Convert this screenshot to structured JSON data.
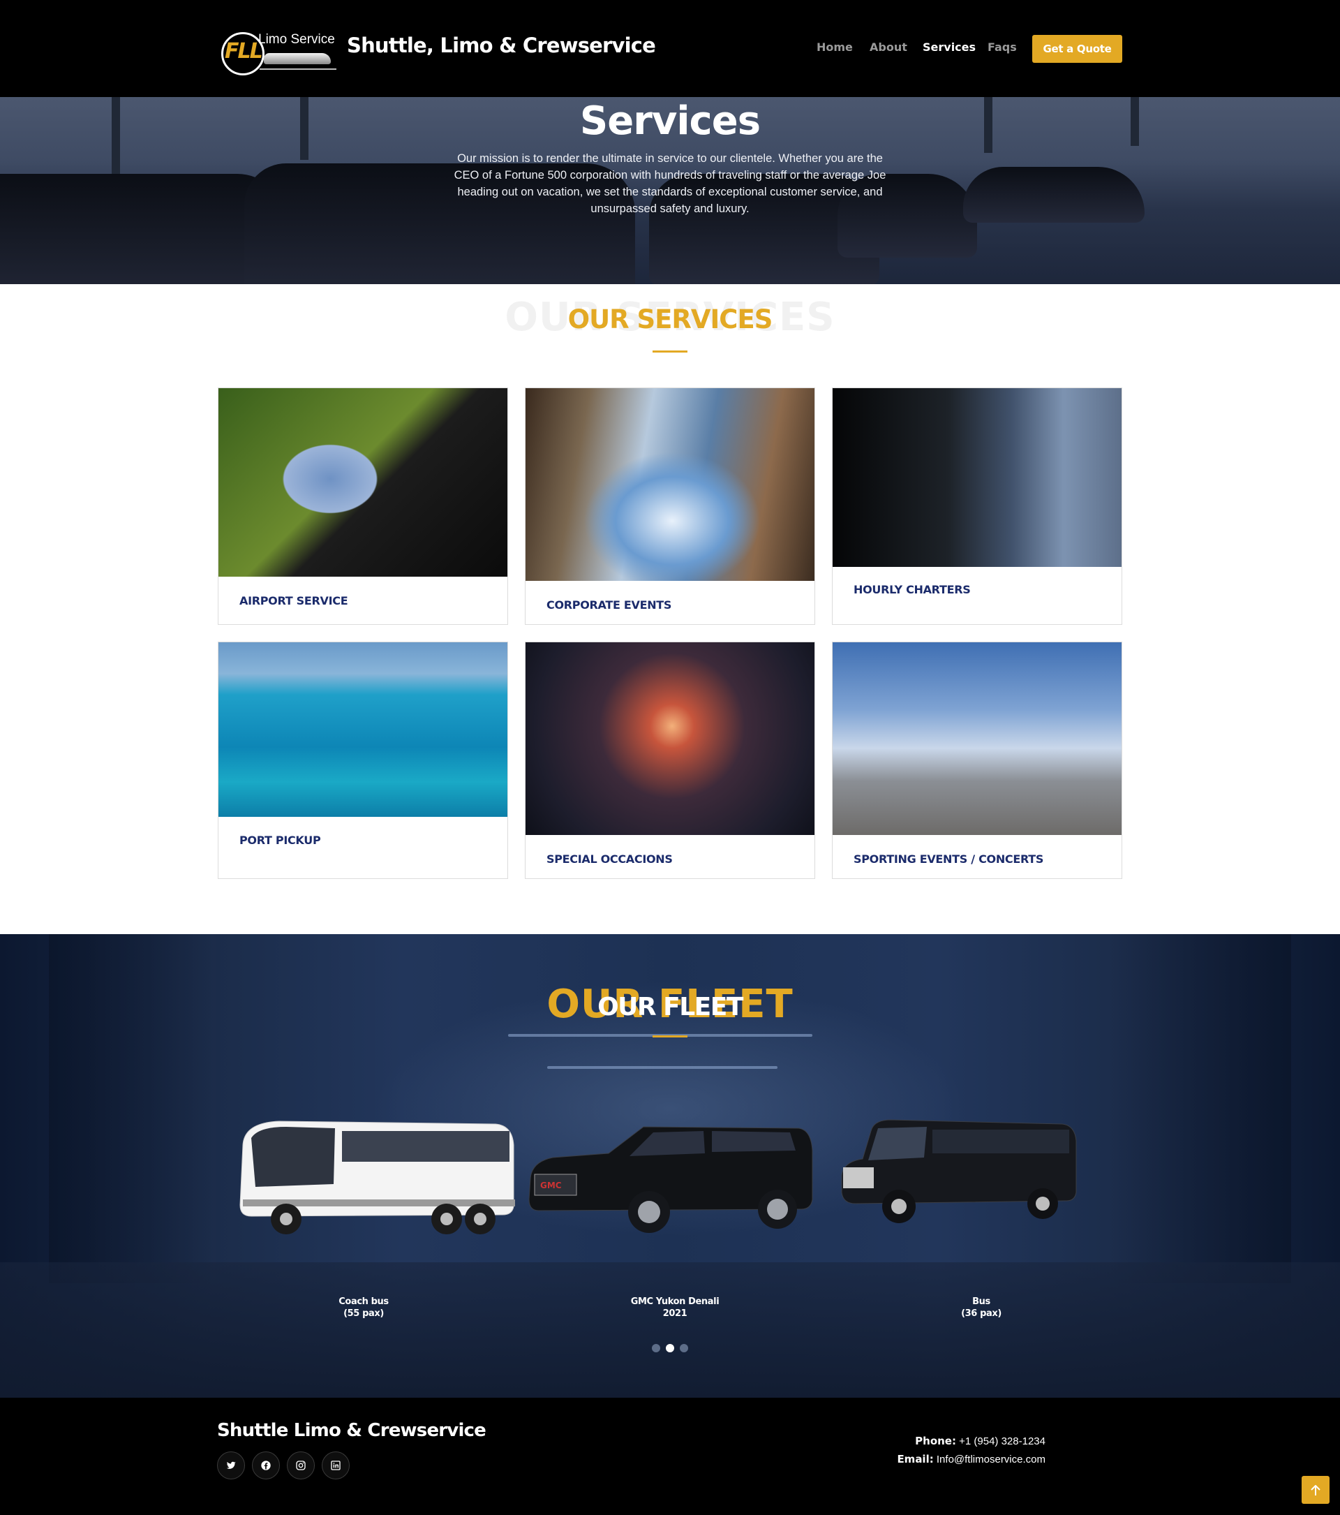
{
  "header": {
    "logo_text": "Limo Service",
    "logo_mark": "FLL",
    "brand": "Shuttle, Limo & Crewservice",
    "nav": [
      "Home",
      "About",
      "Services",
      "Faqs"
    ],
    "active_nav": "Services",
    "quote_button": "Get a Quote"
  },
  "hero": {
    "title": "Services",
    "text": "Our mission is to render the ultimate in service to our clientele. Whether you are the CEO of a Fortune 500 corporation with hundreds of traveling staff or the average Joe heading out on vacation, we set the standards of exceptional customer service, and unsurpassed safety and luxury."
  },
  "services": {
    "ghost": "OUR SERVICES",
    "title": "OUR SERVICES",
    "cards": [
      {
        "label": "AIRPORT SERVICE"
      },
      {
        "label": "CORPORATE EVENTS"
      },
      {
        "label": "HOURLY CHARTERS"
      },
      {
        "label": "PORT PICKUP"
      },
      {
        "label": "SPECIAL OCCACIONS"
      },
      {
        "label": "SPORTING EVENTS / CONCERTS"
      }
    ]
  },
  "fleet": {
    "ghost": "OUR FLEET",
    "title": "OUR FLEET",
    "vehicles": [
      {
        "name": "Coach bus",
        "detail": "(55 pax)"
      },
      {
        "name": "GMC Yukon Denali",
        "detail": "2021"
      },
      {
        "name": "Bus",
        "detail": "(36 pax)"
      }
    ],
    "carousel_active_index": 1
  },
  "footer": {
    "brand": "Shuttle Limo & Crewservice",
    "social": [
      "twitter-icon",
      "facebook-icon",
      "instagram-icon",
      "linkedin-icon"
    ],
    "phone_label": "Phone:",
    "phone": "+1 (954) 328-1234",
    "email_label": "Email:",
    "email": "Info@ftlimoservice.com"
  },
  "colors": {
    "accent": "#e3a924",
    "navy": "#1b2b6b",
    "header_bg": "#000000"
  }
}
